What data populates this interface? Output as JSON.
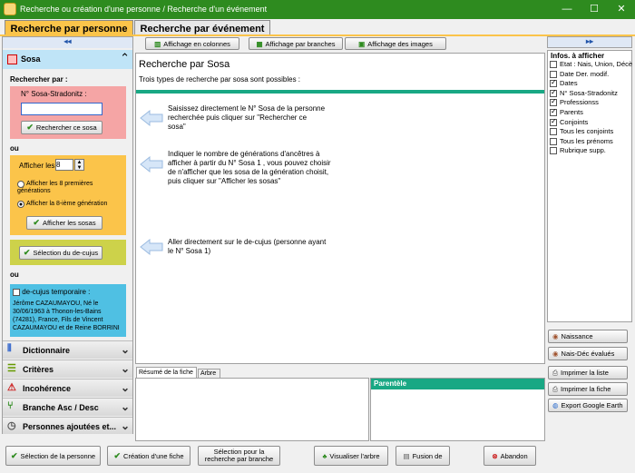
{
  "window": {
    "title": "Recherche ou création d'une personne / Recherche d'un événement",
    "controls": [
      "—",
      "☐",
      "✕"
    ]
  },
  "tabs": [
    {
      "label": "Recherche par personne"
    },
    {
      "label": "Recherche par événement"
    }
  ],
  "left": {
    "collapse": "◂◂",
    "sosa": {
      "title": "Sosa",
      "rechercher_par": "Rechercher par :",
      "num_label": "N° Sosa-Stradonitz :",
      "num_value": "",
      "btn": "Rechercher ce sosa"
    },
    "ou1": "ou",
    "afficher": {
      "label": "Afficher les",
      "value": "8",
      "opt1": "Afficher les 8 premières générations",
      "opt2": "Afficher la 8-ième génération",
      "btn": "Afficher les sosas"
    },
    "decujus_btn": "Sélection du de-cujus",
    "ou2": "ou",
    "temp": {
      "label": "de-cujus temporaire :",
      "text": "Jérôme CAZAUMAYOU, Né le 30/06/1963 à Thonon-les-Bains (74281), France, Fils de Vincent CAZAUMAYOU et de Reine BORRINI"
    },
    "sections": [
      "Dictionnaire",
      "Critères",
      "Incohérence",
      "Branche Asc / Desc",
      "Personnes ajoutées et..."
    ]
  },
  "toolbar": [
    "Affichage en colonnes",
    "Affichage par branches",
    "Affichage des images"
  ],
  "main": {
    "title": "Recherche par Sosa",
    "subtitle": "Trois types de recherche par sosa sont possibles :",
    "instructions": [
      "Saisissez directement le N° Sosa de la personne recherchée puis cliquer sur \"Rechercher ce sosa\"",
      "Indiquer le nombre de générations d'ancêtres à afficher à partir du N° Sosa 1 , vous pouvez choisir de n'afficher que les sosa de la génération choisit, puis cliquer sur \"Afficher les sosas\"",
      "Aller directement sur le de-cujus (personne ayant le N° Sosa 1)"
    ]
  },
  "bottom_tabs": [
    "Résumé de la fiche",
    "Arbre"
  ],
  "parentele": "Parentèle",
  "right": {
    "expand": "▸▸",
    "title": "Infos. à afficher",
    "items": [
      {
        "label": "Etat : Nais, Union, Décè",
        "checked": false
      },
      {
        "label": "Date Der. modif.",
        "checked": false
      },
      {
        "label": "Dates",
        "checked": true
      },
      {
        "label": "N° Sosa-Stradonitz",
        "checked": true
      },
      {
        "label": "Professionss",
        "checked": true
      },
      {
        "label": "Parents",
        "checked": true
      },
      {
        "label": "Conjoints",
        "checked": true
      },
      {
        "label": "Tous les conjoints",
        "checked": false
      },
      {
        "label": "Tous les prénoms",
        "checked": false
      },
      {
        "label": "Rubrique supp.",
        "checked": false
      }
    ],
    "buttons": [
      "Naissance",
      "Nais-Déc évalués",
      "Imprimer la liste",
      "Imprimer la fiche",
      "Export Google Earth"
    ]
  },
  "footer": [
    "Sélection de la personne",
    "Création d'une fiche",
    "Sélection pour la recherche par branche",
    "Visualiser l'arbre",
    "Fusion de",
    "Abandon"
  ],
  "colors": {
    "accent": "#2e8b1f",
    "sosa_header": "#bfe4f7",
    "sosa_box": "#f5a5a5",
    "afficher_box": "#fbc44a",
    "decujus_box": "#cdd24a",
    "temp_box": "#4fc0e3",
    "divider": "#19a884"
  }
}
